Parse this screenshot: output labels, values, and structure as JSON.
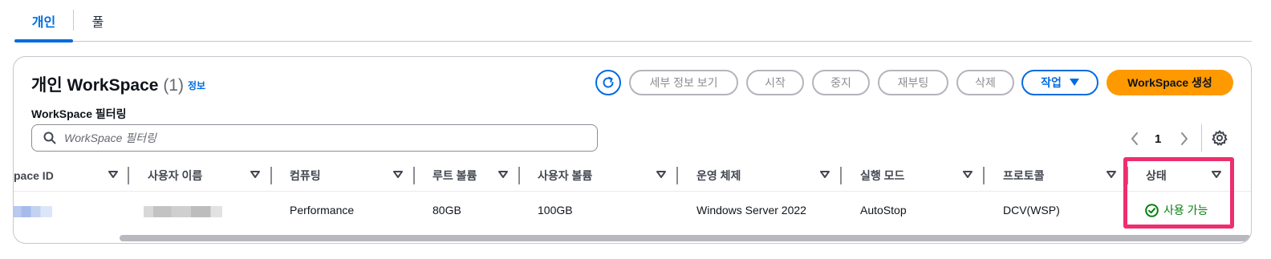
{
  "tabs": [
    {
      "label": "개인",
      "active": true
    },
    {
      "label": "풀",
      "active": false
    }
  ],
  "header": {
    "title": "개인 WorkSpace",
    "count": "(1)",
    "info": "정보"
  },
  "toolbar": {
    "refresh_icon": "refresh-icon",
    "details": "세부 정보 보기",
    "start": "시작",
    "stop": "중지",
    "reboot": "재부팅",
    "delete": "삭제",
    "actions": "작업",
    "create": "WorkSpace 생성"
  },
  "filter": {
    "label": "WorkSpace 필터링",
    "placeholder": "WorkSpace 필터링",
    "value": ""
  },
  "pagination": {
    "current_page": "1"
  },
  "table": {
    "columns": [
      "pace ID",
      "사용자 이름",
      "컴퓨팅",
      "루트 볼륨",
      "사용자 볼륨",
      "운영 체제",
      "실행 모드",
      "프로토콜",
      "상태"
    ],
    "rows": [
      {
        "compute": "Performance",
        "root_volume": "80GB",
        "user_volume": "100GB",
        "os": "Windows Server 2022",
        "running_mode": "AutoStop",
        "protocol": "DCV(WSP)",
        "status": "사용 가능"
      }
    ]
  },
  "colors": {
    "accent": "#006ce0",
    "primary_button": "#ff9900",
    "status_available": "#037f0c",
    "highlight": "#ee2e6e"
  }
}
